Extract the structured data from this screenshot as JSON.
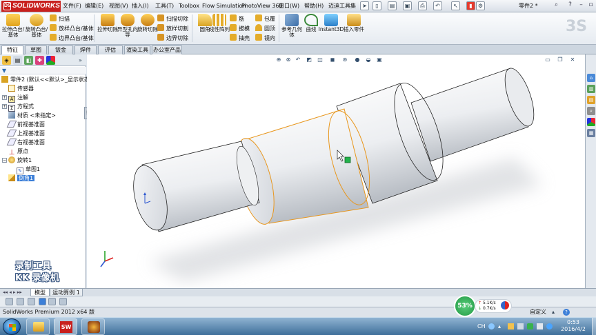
{
  "menubar": {
    "logo": "SOLIDWORKS",
    "menus": [
      "文件(F)",
      "编辑(E)",
      "视图(V)",
      "插入(I)",
      "工具(T)",
      "Toolbox",
      "Flow Simulation",
      "PhotoView 360",
      "窗口(W)",
      "帮助(H)",
      "迈迪工具集"
    ],
    "document_title": "零件2 *"
  },
  "ribbon": {
    "extrude_boss": "拉伸凸台/基体",
    "revolve_boss": "旋转凸台/基体",
    "sweep": "扫描",
    "loft_boss": "放样凸台/基体",
    "boundary_boss": "边界凸台/基体",
    "extrude_cut": "拉伸切除",
    "hole_wizard": "异型孔向导",
    "revolve_cut": "旋转切除",
    "swept_cut": "扫描切除",
    "lofted_cut": "放样切割",
    "boundary_cut": "边界切除",
    "fillet": "圆角",
    "linear_pattern": "线性阵列",
    "rib": "筋",
    "draft": "拔模",
    "shell": "抽壳",
    "wrap": "包覆",
    "dome": "圆顶",
    "mirror": "镜向",
    "ref_geometry": "参考几何体",
    "curves": "曲线",
    "instant3d": "Instant3D",
    "insert_part": "插入零件"
  },
  "tabs": [
    "特征",
    "草图",
    "钣金",
    "焊件",
    "评估",
    "渲染工具",
    "办公室产品"
  ],
  "tree": {
    "root": "零件2  (默认<<默认>_显示状态",
    "items": [
      "传感器",
      "注解",
      "方程式",
      "材质 <未指定>",
      "前视基准面",
      "上视基准面",
      "右视基准面",
      "原点",
      "旋转1",
      "草图1",
      "倒角1"
    ]
  },
  "watermark": {
    "line1": "录制工具",
    "line2": "KK 录像机"
  },
  "bottom_tabs": [
    "模型",
    "运动算例 1"
  ],
  "status": {
    "app": "SolidWorks Premium 2012 x64 版",
    "custom": "自定义",
    "help": "?"
  },
  "network": {
    "percent": "53%",
    "up": "5.1K/s",
    "down": "0.7K/s"
  },
  "taskbar": {
    "lang": "CH",
    "time": "0:53",
    "date": "2016/4/2"
  },
  "colors": {
    "accent": "#3c7fd8",
    "sw_red": "#c8201d",
    "edge_select": "#e8961c",
    "handle": "#22b24c"
  }
}
